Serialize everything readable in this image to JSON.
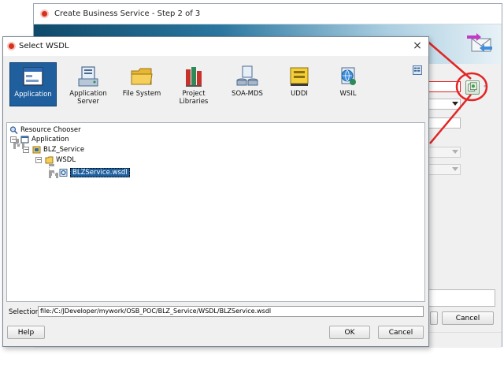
{
  "background_window": {
    "title": "Create Business Service - Step 2 of 3",
    "cancel_label": "Cancel"
  },
  "dialog": {
    "title": "Select WSDL",
    "close_glyph": "×",
    "sources": [
      {
        "label": "Application",
        "icon": "application-icon",
        "selected": true
      },
      {
        "label": "Application Server",
        "icon": "application-server-icon",
        "selected": false
      },
      {
        "label": "File System",
        "icon": "folder-icon",
        "selected": false
      },
      {
        "label": "Project Libraries",
        "icon": "books-icon",
        "selected": false
      },
      {
        "label": "SOA-MDS",
        "icon": "soa-mds-icon",
        "selected": false
      },
      {
        "label": "UDDI",
        "icon": "uddi-icon",
        "selected": false
      },
      {
        "label": "WSIL",
        "icon": "wsil-icon",
        "selected": false
      }
    ],
    "tree": {
      "root": "Resource Chooser",
      "application": "Application",
      "project": "BLZ_Service",
      "folder": "WSDL",
      "file": "BLZService.wsdl"
    },
    "selection_label": "Selection:",
    "selection_value": "file:/C:/JDeveloper/mywork/OSB_POC/BLZ_Service/WSDL/BLZService.wsdl",
    "help_label": "Help",
    "ok_label": "OK",
    "cancel_label": "Cancel"
  },
  "colors": {
    "selection_blue": "#1f5f9e",
    "annotation_red": "#e32525",
    "banner_dark": "#0f4a6a"
  }
}
